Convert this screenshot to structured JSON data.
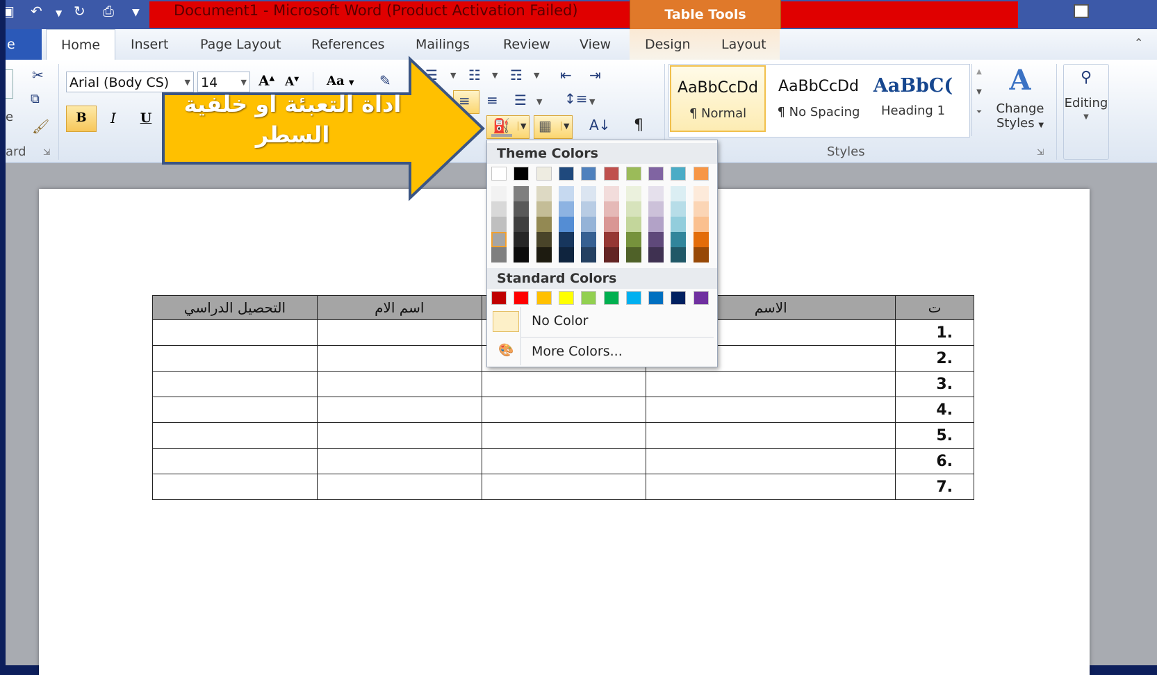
{
  "titlebar": {
    "title": "Document1 - Microsoft Word (Product Activation Failed)",
    "contextual_tab": "Table Tools"
  },
  "tabs": {
    "file": "e",
    "items": [
      "Home",
      "Insert",
      "Page Layout",
      "References",
      "Mailings",
      "Review",
      "View"
    ],
    "contextual": [
      "Design",
      "Layout"
    ],
    "active": "Home"
  },
  "ribbon": {
    "clipboard_label": "ard",
    "font_name": "Arial (Body CS)",
    "font_size": "14",
    "bold": "B",
    "italic": "I",
    "underline": "U",
    "grow_font": "A",
    "shrink_font": "A",
    "change_case": "Aa",
    "sort": "A↓",
    "pilcrow": "¶",
    "styles_label": "Styles",
    "styles": [
      {
        "sample": "AaBbCcDd",
        "name": "¶ Normal"
      },
      {
        "sample": "AaBbCcDd",
        "name": "¶ No Spacing"
      },
      {
        "sample": "AaBbC(",
        "name": "Heading 1"
      }
    ],
    "change_styles_line1": "Change",
    "change_styles_line2": "Styles",
    "editing": "Editing"
  },
  "callout": {
    "text": "اداة التعبئة او خلفية السطر",
    "color": "#ffc000"
  },
  "color_menu": {
    "theme_heading": "Theme Colors",
    "standard_heading": "Standard Colors",
    "no_color": "No Color",
    "more_colors": "More Colors...",
    "theme_top": [
      "#ffffff",
      "#000000",
      "#eeece1",
      "#1f497d",
      "#4f81bd",
      "#c0504d",
      "#9bbb59",
      "#8064a2",
      "#4bacc6",
      "#f79646"
    ],
    "theme_shades": [
      [
        "#f2f2f2",
        "#d8d8d8",
        "#bfbfbf",
        "#a5a5a5",
        "#7f7f7f"
      ],
      [
        "#7f7f7f",
        "#595959",
        "#3f3f3f",
        "#262626",
        "#0c0c0c"
      ],
      [
        "#ddd9c3",
        "#c4bd97",
        "#938953",
        "#494429",
        "#1d1b10"
      ],
      [
        "#c6d9f0",
        "#8db3e2",
        "#548dd4",
        "#17365d",
        "#0f243e"
      ],
      [
        "#dbe5f1",
        "#b8cce4",
        "#95b3d7",
        "#366092",
        "#244061"
      ],
      [
        "#f2dcdb",
        "#e5b9b7",
        "#d99694",
        "#953734",
        "#632423"
      ],
      [
        "#ebf1dd",
        "#d7e3bc",
        "#c3d69b",
        "#76923c",
        "#4f6128"
      ],
      [
        "#e5e0ec",
        "#ccc1d9",
        "#b2a2c7",
        "#5f497a",
        "#3f3151"
      ],
      [
        "#dbeef3",
        "#b7dde8",
        "#92cddc",
        "#31859b",
        "#205867"
      ],
      [
        "#fdeada",
        "#fbd5b5",
        "#fac08f",
        "#e36c09",
        "#974806"
      ]
    ],
    "standard": [
      "#c00000",
      "#ff0000",
      "#ffc000",
      "#ffff00",
      "#92d050",
      "#00b050",
      "#00b0f0",
      "#0070c0",
      "#002060",
      "#7030a0"
    ]
  },
  "table": {
    "headers": [
      "ت",
      "الاسم",
      "",
      "اسم الام",
      "التحصيل الدراسي"
    ],
    "rows": [
      ".1",
      ".2",
      ".3",
      ".4",
      ".5",
      ".6",
      ".7"
    ]
  }
}
